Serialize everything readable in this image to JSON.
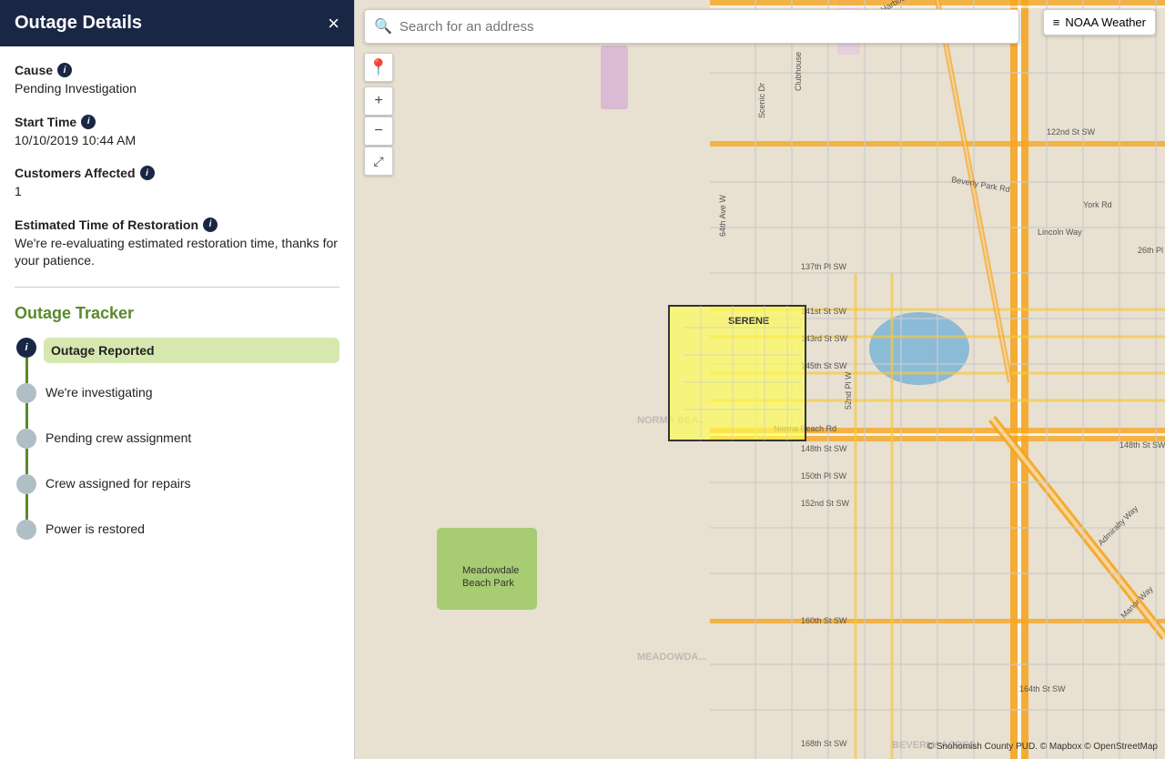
{
  "sidebar": {
    "title": "Outage Details",
    "close_label": "×",
    "cause": {
      "label": "Cause",
      "value": "Pending Investigation"
    },
    "start_time": {
      "label": "Start Time",
      "value": "10/10/2019 10:44 AM"
    },
    "customers_affected": {
      "label": "Customers Affected",
      "value": "1"
    },
    "etr": {
      "label": "Estimated Time of Restoration",
      "value": "We're re-evaluating estimated restoration time, thanks for your patience."
    }
  },
  "tracker": {
    "title": "Outage Tracker",
    "steps": [
      {
        "label": "Outage Reported",
        "active": true
      },
      {
        "label": "We're investigating",
        "active": false
      },
      {
        "label": "Pending crew assignment",
        "active": false
      },
      {
        "label": "Crew assigned for repairs",
        "active": false
      },
      {
        "label": "Power is restored",
        "active": false
      }
    ]
  },
  "map": {
    "search_placeholder": "Search for an address",
    "noaa_label": "NOAA Weather",
    "zoom_in": "+",
    "zoom_out": "−",
    "fullscreen": "⛶",
    "serene_label": "SERENE",
    "attribution": "© Snohomish County PUD. © Mapbox © OpenStreetMap"
  }
}
